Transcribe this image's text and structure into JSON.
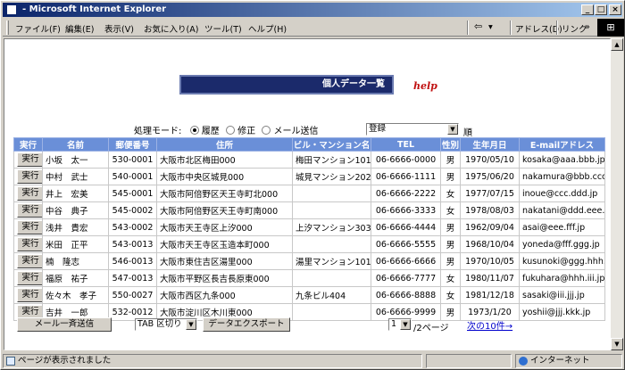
{
  "window": {
    "title": "- Microsoft Internet Explorer",
    "min": "_",
    "max": "□",
    "close": "×"
  },
  "menu": [
    "ファイル(F)",
    "編集(E)",
    "表示(V)",
    "お気に入り(A)",
    "ツール(T)",
    "ヘルプ(H)"
  ],
  "toolbar": {
    "back_label": "⇦",
    "back_dd": "▾",
    "address_label": "アドレス(D)",
    "links_label": "リンク",
    "links_arrow": "»",
    "ie_logo": "⊞"
  },
  "page": {
    "banner": "個人データ一覧",
    "help": "help",
    "mode_label": "処理モード:",
    "modes": [
      "履歴",
      "修正",
      "メール送信"
    ],
    "sort_value": "登録",
    "sort_suffix": "順",
    "columns": [
      "実行",
      "名前",
      "郵便番号",
      "住所",
      "ビル・マンション名",
      "TEL",
      "性別",
      "生年月日",
      "E-mailアドレス"
    ],
    "rows": [
      {
        "btn": "実行",
        "name": "小坂　太一",
        "zip": "530-0001",
        "addr": "大阪市北区梅田000",
        "bldg": "梅田マンション101",
        "tel": "06-6666-0000",
        "sex": "男",
        "dob": "1970/05/10",
        "email": "kosaka@aaa.bbb.jp"
      },
      {
        "btn": "実行",
        "name": "中村　武士",
        "zip": "540-0001",
        "addr": "大阪市中央区城見000",
        "bldg": "城見マンション202",
        "tel": "06-6666-1111",
        "sex": "男",
        "dob": "1975/06/20",
        "email": "nakamura@bbb.ccc.jp"
      },
      {
        "btn": "実行",
        "name": "井上　宏美",
        "zip": "545-0001",
        "addr": "大阪市阿倍野区天王寺町北000",
        "bldg": "",
        "tel": "06-6666-2222",
        "sex": "女",
        "dob": "1977/07/15",
        "email": "inoue@ccc.ddd.jp"
      },
      {
        "btn": "実行",
        "name": "中谷　典子",
        "zip": "545-0002",
        "addr": "大阪市阿倍野区天王寺町南000",
        "bldg": "",
        "tel": "06-6666-3333",
        "sex": "女",
        "dob": "1978/08/03",
        "email": "nakatani@ddd.eee.jp"
      },
      {
        "btn": "実行",
        "name": "浅井　貴宏",
        "zip": "543-0002",
        "addr": "大阪市天王寺区上汐000",
        "bldg": "上汐マンション303",
        "tel": "06-6666-4444",
        "sex": "男",
        "dob": "1962/09/04",
        "email": "asai@eee.fff.jp"
      },
      {
        "btn": "実行",
        "name": "米田　正平",
        "zip": "543-0013",
        "addr": "大阪市天王寺区玉造本町000",
        "bldg": "",
        "tel": "06-6666-5555",
        "sex": "男",
        "dob": "1968/10/04",
        "email": "yoneda@fff.ggg.jp"
      },
      {
        "btn": "実行",
        "name": "楠　隆志",
        "zip": "546-0013",
        "addr": "大阪市東住吉区湯里000",
        "bldg": "湯里マンション101",
        "tel": "06-6666-6666",
        "sex": "男",
        "dob": "1970/10/05",
        "email": "kusunoki@ggg.hhh.jp"
      },
      {
        "btn": "実行",
        "name": "福原　祐子",
        "zip": "547-0013",
        "addr": "大阪市平野区長吉長原東000",
        "bldg": "",
        "tel": "06-6666-7777",
        "sex": "女",
        "dob": "1980/11/07",
        "email": "fukuhara@hhh.iii.jp"
      },
      {
        "btn": "実行",
        "name": "佐々木　孝子",
        "zip": "550-0027",
        "addr": "大阪市西区九条000",
        "bldg": "九条ビル404",
        "tel": "06-6666-8888",
        "sex": "女",
        "dob": "1981/12/18",
        "email": "sasaki@iii.jjj.jp"
      },
      {
        "btn": "実行",
        "name": "吉井　一郎",
        "zip": "532-0012",
        "addr": "大阪市淀川区木川東000",
        "bldg": "",
        "tel": "06-6666-9999",
        "sex": "男",
        "dob": "1973/1/20",
        "email": "yoshii@jjj.kkk.jp"
      }
    ],
    "bulk_mail_button": "メール一斉送信",
    "tab_select": "TAB 区切り",
    "export_button": "データエクスポート",
    "page_select": "1",
    "page_suffix": "/2ページ",
    "next_link": "次の10件→"
  },
  "status": {
    "left": "ページが表示されました",
    "zone": "インターネット"
  }
}
